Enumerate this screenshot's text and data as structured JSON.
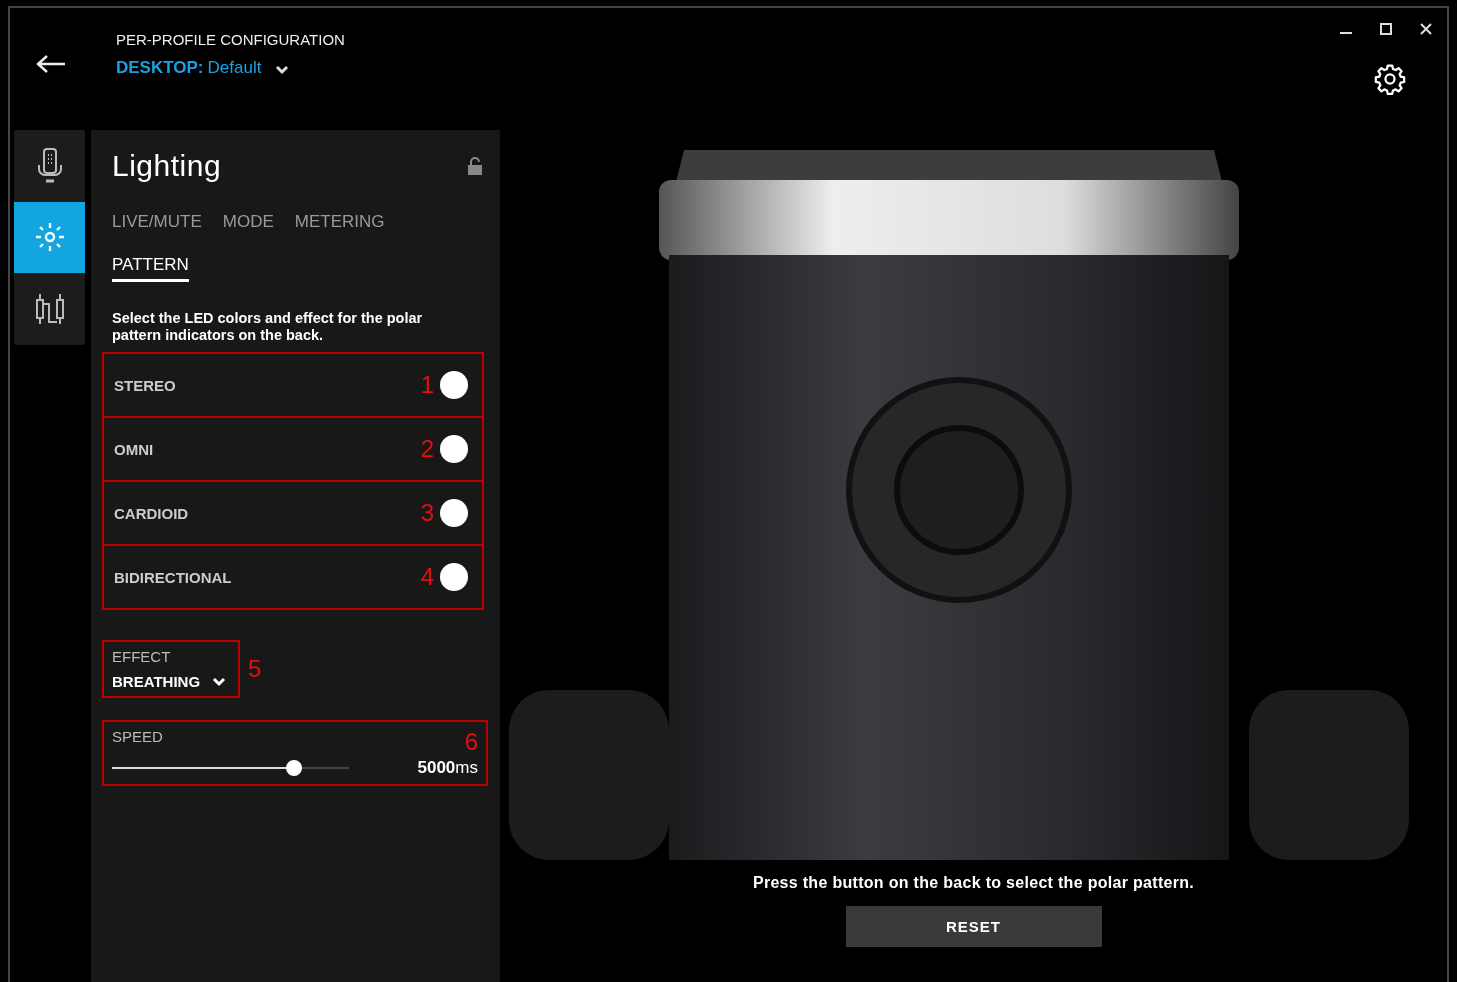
{
  "header": {
    "title": "PER-PROFILE CONFIGURATION",
    "profile_prefix": "DESKTOP:",
    "profile_name": "Default"
  },
  "sidebar": {
    "items": [
      {
        "kind": "microphone",
        "selected": false
      },
      {
        "kind": "lighting",
        "selected": true
      },
      {
        "kind": "cable",
        "selected": false
      }
    ]
  },
  "panel": {
    "title": "Lighting",
    "tabs": [
      {
        "label": "LIVE/MUTE",
        "selected": false
      },
      {
        "label": "MODE",
        "selected": false
      },
      {
        "label": "METERING",
        "selected": false
      },
      {
        "label": "PATTERN",
        "selected": true
      }
    ],
    "description": "Select the LED colors and effect for the polar pattern indicators on the back.",
    "patterns": [
      {
        "label": "STEREO",
        "marker": "1",
        "color": "#ffffff"
      },
      {
        "label": "OMNI",
        "marker": "2",
        "color": "#ffffff"
      },
      {
        "label": "CARDIOID",
        "marker": "3",
        "color": "#ffffff"
      },
      {
        "label": "BIDIRECTIONAL",
        "marker": "4",
        "color": "#ffffff"
      }
    ],
    "effect": {
      "label": "EFFECT",
      "value": "BREATHING",
      "marker": "5"
    },
    "speed": {
      "label": "SPEED",
      "level": 0.77,
      "reading": "**5000**ms",
      "marker": "6"
    }
  },
  "preview": {
    "caption": "Press the button on the back to select the polar pattern.",
    "button": "RESET"
  }
}
